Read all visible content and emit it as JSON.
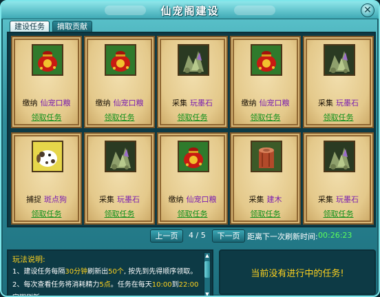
{
  "window": {
    "title": "仙宠阁建设"
  },
  "tabs": [
    {
      "label": "建设任务",
      "active": true
    },
    {
      "label": "摘取贡献",
      "active": false
    }
  ],
  "accept_label": "领取任务",
  "cards": [
    {
      "action": "缴纳",
      "target": "仙宠口粮",
      "icon": "food-bag-icon"
    },
    {
      "action": "缴纳",
      "target": "仙宠口粮",
      "icon": "food-bag-icon"
    },
    {
      "action": "采集",
      "target": "玩墨石",
      "icon": "ore-crystal-icon"
    },
    {
      "action": "缴纳",
      "target": "仙宠口粮",
      "icon": "food-bag-icon"
    },
    {
      "action": "采集",
      "target": "玩墨石",
      "icon": "ore-crystal-icon"
    },
    {
      "action": "捕捉",
      "target": "斑点狗",
      "icon": "spotted-dog-icon"
    },
    {
      "action": "采集",
      "target": "玩墨石",
      "icon": "ore-crystal-icon"
    },
    {
      "action": "缴纳",
      "target": "仙宠口粮",
      "icon": "food-bag-icon"
    },
    {
      "action": "采集",
      "target": "建木",
      "icon": "tree-stump-icon"
    },
    {
      "action": "采集",
      "target": "玩墨石",
      "icon": "ore-crystal-icon"
    }
  ],
  "pager": {
    "prev_label": "上一页",
    "page_indicator": "4 / 5",
    "next_label": "下一页",
    "refresh_label": "距离下一次刷新时间:",
    "refresh_timer": "00:26:23"
  },
  "rules": {
    "title": "玩法说明:",
    "line1_a": "1、建设任务每隔",
    "line1_b": "30分钟",
    "line1_c": "刷新出",
    "line1_d": "50个",
    "line1_e": ", 按先到先得顺序领取。",
    "line2_a": "2、每次查看任务将消耗精力",
    "line2_b": "5点",
    "line2_c": "。任务在每天",
    "line2_d": "10:00",
    "line2_e": "到",
    "line2_f": "22:00",
    "line3": "定期刷新"
  },
  "status": {
    "message": "当前没有进行中的任务!"
  },
  "colors": {
    "accent_yellow": "#ffd21e",
    "link_green": "#0e8f1a",
    "timer_green": "#5dff5a",
    "target_purple": "#7a1db0"
  }
}
